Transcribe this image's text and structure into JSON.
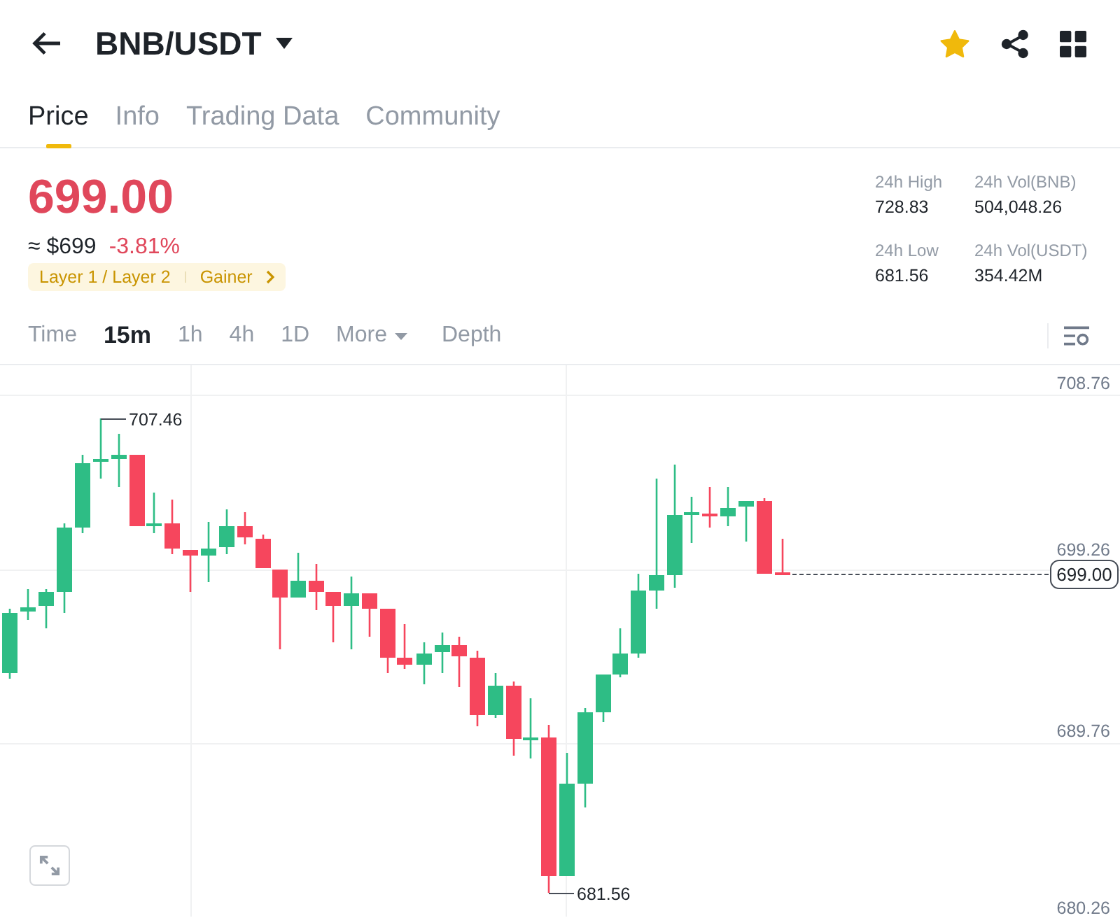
{
  "header": {
    "title": "BNB/USDT",
    "favorite": true
  },
  "tabs": [
    {
      "label": "Price",
      "selected": true
    },
    {
      "label": "Info",
      "selected": false
    },
    {
      "label": "Trading Data",
      "selected": false
    },
    {
      "label": "Community",
      "selected": false
    }
  ],
  "price": {
    "last": "699.00",
    "fiat": "≈ $699",
    "change": "-3.81%",
    "falling": true
  },
  "tags": [
    {
      "label": "Layer 1 / Layer 2"
    },
    {
      "label": "Gainer"
    }
  ],
  "stats": [
    {
      "label": "24h High",
      "value": "728.83"
    },
    {
      "label": "24h Vol(BNB)",
      "value": "504,048.26"
    },
    {
      "label": "24h Low",
      "value": "681.56"
    },
    {
      "label": "24h Vol(USDT)",
      "value": "354.42M"
    }
  ],
  "intervals": [
    {
      "label": "Time",
      "selected": false,
      "kind": "option"
    },
    {
      "label": "15m",
      "selected": true,
      "kind": "option"
    },
    {
      "label": "1h",
      "selected": false,
      "kind": "option"
    },
    {
      "label": "4h",
      "selected": false,
      "kind": "option"
    },
    {
      "label": "1D",
      "selected": false,
      "kind": "option"
    },
    {
      "label": "More",
      "selected": false,
      "kind": "dropdown"
    },
    {
      "label": "Depth",
      "selected": false,
      "kind": "option"
    }
  ],
  "chart": {
    "y_axis_labels": [
      "708.76",
      "699.26",
      "689.76",
      "680.26"
    ],
    "high_marker": "707.46",
    "low_marker": "681.56",
    "last_price": "699.00"
  }
}
